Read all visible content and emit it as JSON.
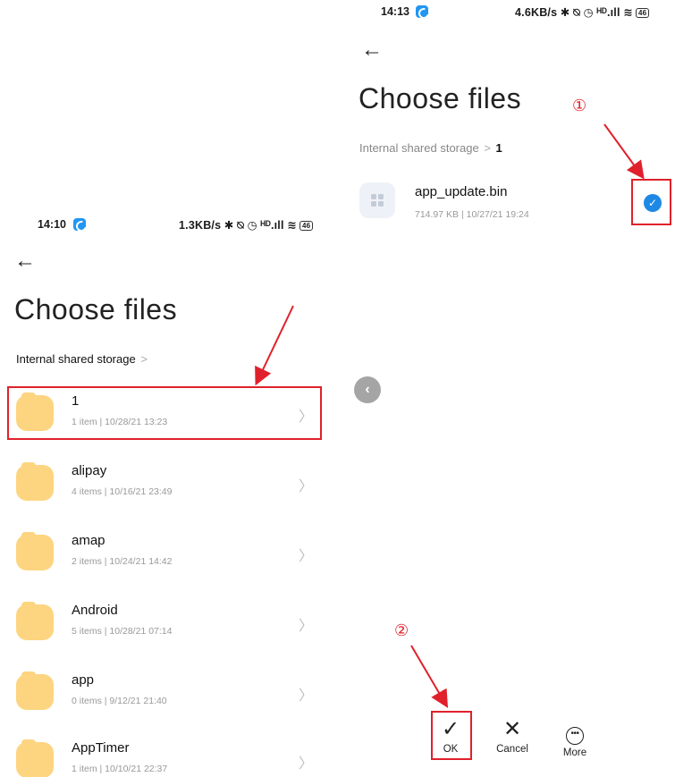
{
  "left_screen": {
    "status": {
      "time": "14:10",
      "indicators": "1.3KB/s ✱ ⍉ ◷ ᴴᴰ.ıll ≋",
      "battery": "46"
    },
    "title": "Choose files",
    "breadcrumb": {
      "root": "Internal shared storage",
      "separator": ">"
    },
    "folders": [
      {
        "name": "1",
        "meta": "1 item  |  10/28/21 13:23"
      },
      {
        "name": "alipay",
        "meta": "4 items  |  10/16/21 23:49"
      },
      {
        "name": "amap",
        "meta": "2 items  |  10/24/21 14:42"
      },
      {
        "name": "Android",
        "meta": "5 items  |  10/28/21 07:14"
      },
      {
        "name": "app",
        "meta": "0 items  |  9/12/21 21:40"
      },
      {
        "name": "AppTimer",
        "meta": "1 item  |  10/10/21 22:37"
      }
    ]
  },
  "right_screen": {
    "status": {
      "time": "14:13",
      "indicators": "4.6KB/s ✱ ⍉ ◷ ᴴᴰ.ıll ≋",
      "battery": "46"
    },
    "title": "Choose files",
    "breadcrumb": {
      "root": "Internal shared storage",
      "separator": ">",
      "current": "1"
    },
    "file": {
      "name": "app_update.bin",
      "meta": "714.97 KB  |  10/27/21 19:24",
      "selected": true
    },
    "actions": {
      "ok": "OK",
      "cancel": "Cancel",
      "more": "More"
    }
  },
  "annotations": {
    "step1": "①",
    "step2": "②",
    "highlight_color": "#e0212b"
  },
  "colors": {
    "folder": "#fdd580",
    "accent": "#1e88e5",
    "annotation": "#e0212b"
  },
  "icons": [
    "back-arrow-icon",
    "folder-icon",
    "chevron-right-icon",
    "file-grid-icon",
    "checkmark-icon",
    "close-icon",
    "more-icon"
  ]
}
